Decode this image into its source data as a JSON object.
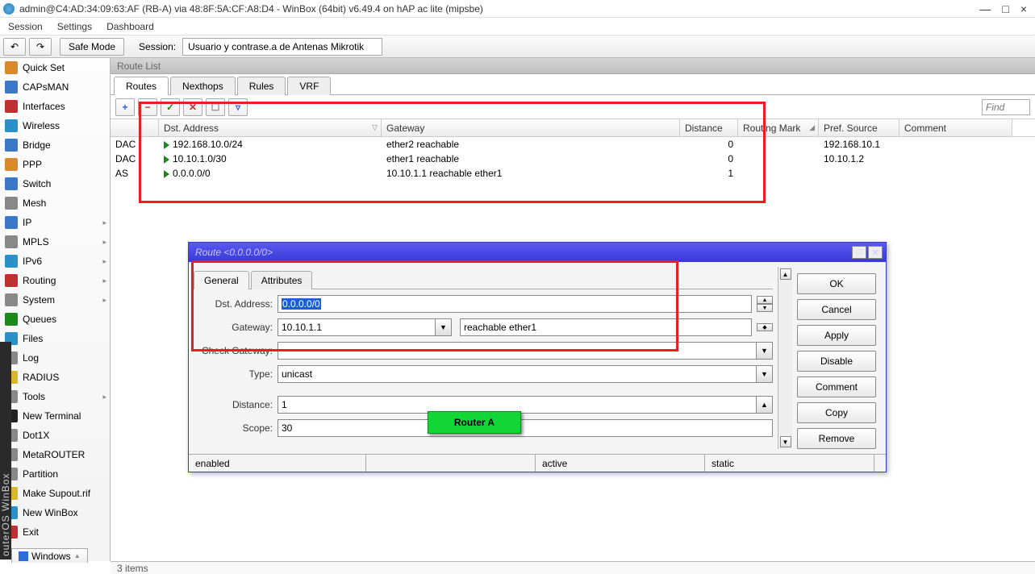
{
  "window": {
    "title": "admin@C4:AD:34:09:63:AF (RB-A) via 48:8F:5A:CF:A8:D4 - WinBox (64bit) v6.49.4 on hAP ac lite (mipsbe)",
    "min": "—",
    "max": "□",
    "close": "×"
  },
  "menu": {
    "session": "Session",
    "settings": "Settings",
    "dashboard": "Dashboard"
  },
  "toolbar": {
    "back": "↶",
    "fwd": "↷",
    "safemode": "Safe Mode",
    "sessionlabel": "Session:",
    "sessionvalue": "Usuario y contrase.a de Antenas Mikrotik"
  },
  "sidebar": [
    {
      "label": "Quick Set",
      "icon": "#d88a2a",
      "arrow": false
    },
    {
      "label": "CAPsMAN",
      "icon": "#3a78c8",
      "arrow": false
    },
    {
      "label": "Interfaces",
      "icon": "#c03030",
      "arrow": false
    },
    {
      "label": "Wireless",
      "icon": "#2a90c8",
      "arrow": false
    },
    {
      "label": "Bridge",
      "icon": "#3a78c8",
      "arrow": false
    },
    {
      "label": "PPP",
      "icon": "#d88a2a",
      "arrow": false
    },
    {
      "label": "Switch",
      "icon": "#3a78c8",
      "arrow": false
    },
    {
      "label": "Mesh",
      "icon": "#888",
      "arrow": false
    },
    {
      "label": "IP",
      "icon": "#3a78c8",
      "arrow": true
    },
    {
      "label": "MPLS",
      "icon": "#888",
      "arrow": true
    },
    {
      "label": "IPv6",
      "icon": "#2a90c8",
      "arrow": true
    },
    {
      "label": "Routing",
      "icon": "#c03030",
      "arrow": true
    },
    {
      "label": "System",
      "icon": "#888",
      "arrow": true
    },
    {
      "label": "Queues",
      "icon": "#1a8a1a",
      "arrow": false
    },
    {
      "label": "Files",
      "icon": "#2a90c8",
      "arrow": false
    },
    {
      "label": "Log",
      "icon": "#888",
      "arrow": false
    },
    {
      "label": "RADIUS",
      "icon": "#d8b82a",
      "arrow": false
    },
    {
      "label": "Tools",
      "icon": "#888",
      "arrow": true
    },
    {
      "label": "New Terminal",
      "icon": "#222",
      "arrow": false
    },
    {
      "label": "Dot1X",
      "icon": "#888",
      "arrow": false
    },
    {
      "label": "MetaROUTER",
      "icon": "#888",
      "arrow": false
    },
    {
      "label": "Partition",
      "icon": "#888",
      "arrow": false
    },
    {
      "label": "Make Supout.rif",
      "icon": "#d8b82a",
      "arrow": false
    },
    {
      "label": "New WinBox",
      "icon": "#2a90c8",
      "arrow": false
    },
    {
      "label": "Exit",
      "icon": "#c03030",
      "arrow": false
    }
  ],
  "routelist": {
    "title": "Route List",
    "tabs": [
      "Routes",
      "Nexthops",
      "Rules",
      "VRF"
    ],
    "activeTab": 0,
    "find": "Find",
    "toolbar_icons": [
      "+",
      "−",
      "✓",
      "✕",
      "☐",
      "▿"
    ],
    "columns": [
      "",
      "Dst. Address",
      "Gateway",
      "Distance",
      "Routing Mark",
      "Pref. Source",
      "Comment"
    ],
    "sortcol": 1,
    "rows": [
      {
        "flag": "DAC",
        "dst": "192.168.10.0/24",
        "gw": "ether2 reachable",
        "dist": "0",
        "mark": "",
        "src": "192.168.10.1",
        "comment": ""
      },
      {
        "flag": "DAC",
        "dst": "10.10.1.0/30",
        "gw": "ether1 reachable",
        "dist": "0",
        "mark": "",
        "src": "10.10.1.2",
        "comment": ""
      },
      {
        "flag": "AS",
        "dst": "0.0.0.0/0",
        "gw": "10.10.1.1 reachable ether1",
        "dist": "1",
        "mark": "",
        "src": "",
        "comment": ""
      }
    ]
  },
  "dialog": {
    "title": "Route <0.0.0.0/0>",
    "tabs": [
      "General",
      "Attributes"
    ],
    "activeTab": 0,
    "fields": {
      "dstaddress_label": "Dst. Address:",
      "dstaddress": "0.0.0.0/0",
      "gateway_label": "Gateway:",
      "gateway": "10.10.1.1",
      "gateway_status": "reachable ether1",
      "checkgw_label": "Check Gateway:",
      "checkgw": "",
      "type_label": "Type:",
      "type": "unicast",
      "distance_label": "Distance:",
      "distance": "1",
      "scope_label": "Scope:",
      "scope": "30"
    },
    "buttons": [
      "OK",
      "Cancel",
      "Apply",
      "Disable",
      "Comment",
      "Copy",
      "Remove"
    ],
    "status": [
      "enabled",
      "",
      "active",
      "static"
    ]
  },
  "callout": "Router A",
  "statusbar": "3 items",
  "windowsmenu": "Windows",
  "sidetext": "outerOS  WinBox"
}
